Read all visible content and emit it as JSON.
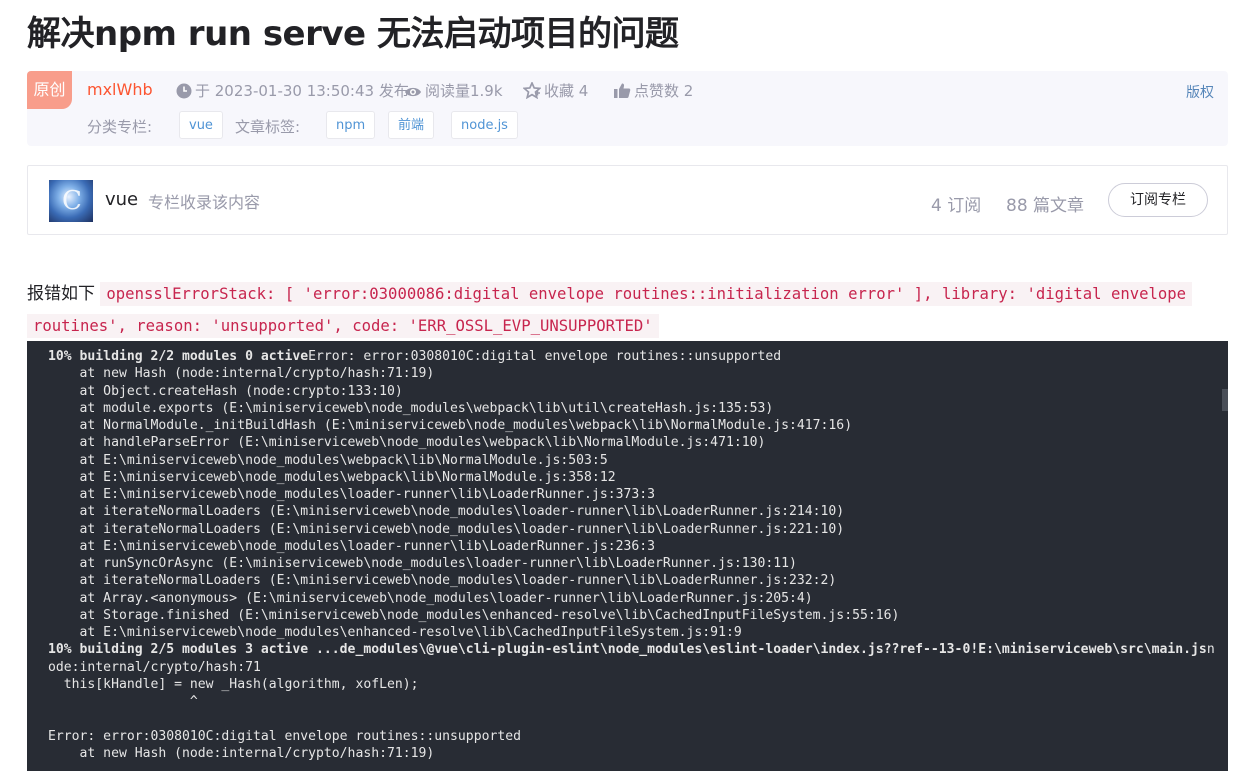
{
  "article": {
    "title": "解决npm run serve 无法启动项目的问题"
  },
  "meta": {
    "badge": "原创",
    "author": "mxlWhb",
    "publish": "于 2023-01-30 13:50:43 发布",
    "reads": "阅读量1.9k",
    "favorites": "收藏 4",
    "likes": "点赞数 2",
    "copyright": "版权",
    "category_label": "分类专栏:",
    "category_tags": [
      "vue"
    ],
    "article_tags_label": "文章标签:",
    "article_tags": [
      "npm",
      "前端",
      "node.js"
    ]
  },
  "column": {
    "thumb_letter": "C",
    "name": "vue",
    "desc": "专栏收录该内容",
    "subscribers": "4 订阅",
    "articles": "88 篇文章",
    "subscribe_label": "订阅专栏"
  },
  "error_intro": {
    "lead": "报错如下",
    "code_1": "opensslErrorStack: [ 'error:03000086:digital envelope routines::initialization error' ], library: 'digital envelope",
    "code_2": "routines', reason: 'unsupported', code: 'ERR_OSSL_EVP_UNSUPPORTED'"
  },
  "code_block": {
    "line_1_bold": "10% building 2/2 modules 0 active",
    "line_1_rest": "Error: error:0308010C:digital envelope routines::unsupported",
    "line_2": "    at new Hash (node:internal/crypto/hash:71:19)",
    "line_3": "    at Object.createHash (node:crypto:133:10)",
    "line_4": "    at module.exports (E:\\miniserviceweb\\node_modules\\webpack\\lib\\util\\createHash.js:135:53)",
    "line_5": "    at NormalModule._initBuildHash (E:\\miniserviceweb\\node_modules\\webpack\\lib\\NormalModule.js:417:16)",
    "line_6": "    at handleParseError (E:\\miniserviceweb\\node_modules\\webpack\\lib\\NormalModule.js:471:10)",
    "line_7": "    at E:\\miniserviceweb\\node_modules\\webpack\\lib\\NormalModule.js:503:5",
    "line_8": "    at E:\\miniserviceweb\\node_modules\\webpack\\lib\\NormalModule.js:358:12",
    "line_9": "    at E:\\miniserviceweb\\node_modules\\loader-runner\\lib\\LoaderRunner.js:373:3",
    "line_10": "    at iterateNormalLoaders (E:\\miniserviceweb\\node_modules\\loader-runner\\lib\\LoaderRunner.js:214:10)",
    "line_11": "    at iterateNormalLoaders (E:\\miniserviceweb\\node_modules\\loader-runner\\lib\\LoaderRunner.js:221:10)",
    "line_12": "    at E:\\miniserviceweb\\node_modules\\loader-runner\\lib\\LoaderRunner.js:236:3",
    "line_13": "    at runSyncOrAsync (E:\\miniserviceweb\\node_modules\\loader-runner\\lib\\LoaderRunner.js:130:11)",
    "line_14": "    at iterateNormalLoaders (E:\\miniserviceweb\\node_modules\\loader-runner\\lib\\LoaderRunner.js:232:2)",
    "line_15": "    at Array.<anonymous> (E:\\miniserviceweb\\node_modules\\loader-runner\\lib\\LoaderRunner.js:205:4)",
    "line_16": "    at Storage.finished (E:\\miniserviceweb\\node_modules\\enhanced-resolve\\lib\\CachedInputFileSystem.js:55:16)",
    "line_17": "    at E:\\miniserviceweb\\node_modules\\enhanced-resolve\\lib\\CachedInputFileSystem.js:91:9",
    "line_18_bold": "10% building 2/5 modules 3 active ...de_modules\\@vue\\cli-plugin-eslint\\node_modules\\eslint-loader\\index.js??ref--13-0!E:\\miniserviceweb\\src\\main.js",
    "line_18_rest": "n",
    "line_19": "ode:internal/crypto/hash:71",
    "line_20": "  this[kHandle] = new _Hash(algorithm, xofLen);",
    "line_21": "                  ^",
    "line_22": "",
    "line_23": "Error: error:0308010C:digital envelope routines::unsupported",
    "line_24": "    at new Hash (node:internal/crypto/hash:71:19)"
  },
  "colors": {
    "accent": "#fc5531",
    "badge": "#f89d8b",
    "link": "#5094d5",
    "code_bg": "#282c34",
    "inline_code": "#c7254e"
  },
  "icons": [
    "clock-icon",
    "eye-icon",
    "star-icon",
    "thumbs-up-icon"
  ]
}
